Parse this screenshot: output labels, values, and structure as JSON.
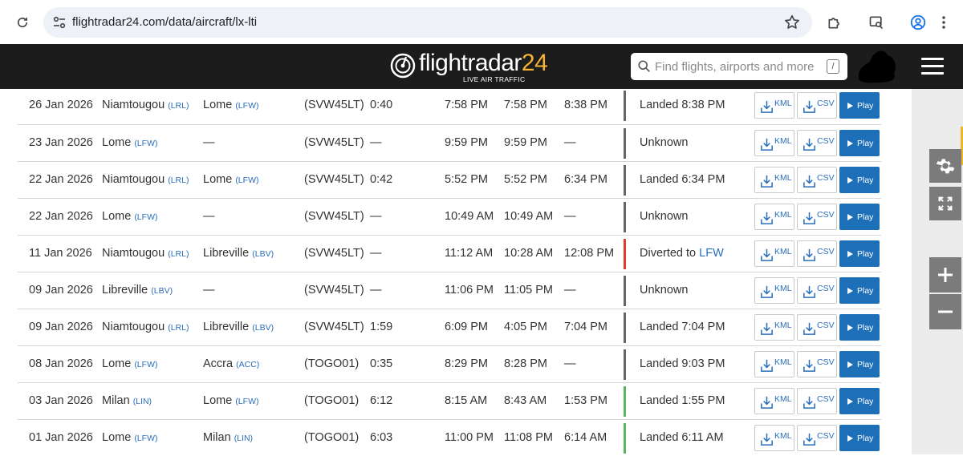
{
  "browser": {
    "url": "flightradar24.com/data/aircraft/lx-lti"
  },
  "header": {
    "logo_text": "flightradar",
    "logo_number": "24",
    "logo_tagline": "LIVE AIR TRAFFIC",
    "search_placeholder": "Find flights, airports and more",
    "search_shortcut": "/"
  },
  "flights": [
    {
      "date": "26 Jan 2026",
      "from": "Niamtougou",
      "from_code": "(LRL)",
      "to": "Lome",
      "to_code": "(LFW)",
      "flight": "(SVW45LT)",
      "duration": "0:40",
      "std": "7:58 PM",
      "atd": "7:58 PM",
      "sta": "8:38 PM",
      "status": "Landed 8:38 PM",
      "status_color": "gray"
    },
    {
      "date": "23 Jan 2026",
      "from": "Lome",
      "from_code": "(LFW)",
      "to": "—",
      "to_code": "",
      "flight": "(SVW45LT)",
      "duration": "—",
      "std": "9:59 PM",
      "atd": "9:59 PM",
      "sta": "—",
      "status": "Unknown",
      "status_color": "gray"
    },
    {
      "date": "22 Jan 2026",
      "from": "Niamtougou",
      "from_code": "(LRL)",
      "to": "Lome",
      "to_code": "(LFW)",
      "flight": "(SVW45LT)",
      "duration": "0:42",
      "std": "5:52 PM",
      "atd": "5:52 PM",
      "sta": "6:34 PM",
      "status": "Landed 6:34 PM",
      "status_color": "gray"
    },
    {
      "date": "22 Jan 2026",
      "from": "Lome",
      "from_code": "(LFW)",
      "to": "—",
      "to_code": "",
      "flight": "(SVW45LT)",
      "duration": "—",
      "std": "10:49 AM",
      "atd": "10:49 AM",
      "sta": "—",
      "status": "Unknown",
      "status_color": "gray"
    },
    {
      "date": "11 Jan 2026",
      "from": "Niamtougou",
      "from_code": "(LRL)",
      "to": "Libreville",
      "to_code": "(LBV)",
      "flight": "(SVW45LT)",
      "duration": "—",
      "std": "11:12 AM",
      "atd": "10:28 AM",
      "sta": "12:08 PM",
      "status": "Diverted to",
      "status_airport": "LFW",
      "status_color": "red"
    },
    {
      "date": "09 Jan 2026",
      "from": "Libreville",
      "from_code": "(LBV)",
      "to": "—",
      "to_code": "",
      "flight": "(SVW45LT)",
      "duration": "—",
      "std": "11:06 PM",
      "atd": "11:05 PM",
      "sta": "—",
      "status": "Unknown",
      "status_color": "gray"
    },
    {
      "date": "09 Jan 2026",
      "from": "Niamtougou",
      "from_code": "(LRL)",
      "to": "Libreville",
      "to_code": "(LBV)",
      "flight": "(SVW45LT)",
      "duration": "1:59",
      "std": "6:09 PM",
      "atd": "4:05 PM",
      "sta": "7:04 PM",
      "status": "Landed 7:04 PM",
      "status_color": "gray"
    },
    {
      "date": "08 Jan 2026",
      "from": "Lome",
      "from_code": "(LFW)",
      "to": "Accra",
      "to_code": "(ACC)",
      "flight": "(TOGO01)",
      "duration": "0:35",
      "std": "8:29 PM",
      "atd": "8:28 PM",
      "sta": "—",
      "status": "Landed 9:03 PM",
      "status_color": "gray"
    },
    {
      "date": "03 Jan 2026",
      "from": "Milan",
      "from_code": "(LIN)",
      "to": "Lome",
      "to_code": "(LFW)",
      "flight": "(TOGO01)",
      "duration": "6:12",
      "std": "8:15 AM",
      "atd": "8:43 AM",
      "sta": "1:53 PM",
      "status": "Landed 1:55 PM",
      "status_color": "green"
    },
    {
      "date": "01 Jan 2026",
      "from": "Lome",
      "from_code": "(LFW)",
      "to": "Milan",
      "to_code": "(LIN)",
      "flight": "(TOGO01)",
      "duration": "6:03",
      "std": "11:00 PM",
      "atd": "11:08 PM",
      "sta": "6:14 AM",
      "status": "Landed 6:11 AM",
      "status_color": "green"
    }
  ],
  "buttons": {
    "kml": "KML",
    "csv": "CSV",
    "play": "Play"
  },
  "colors": {
    "header_bg": "#1c1c1c",
    "accent_blue": "#1d6fb8",
    "link_blue": "#2a6ebb",
    "diverted_red": "#e03c31",
    "landed_green": "#57b95c",
    "logo_yellow": "#f4b333"
  },
  "icons": {
    "reload": "reload-icon",
    "site_settings": "tune-icon",
    "bookmark": "star-icon",
    "extensions": "puzzle-icon",
    "screen_search": "lens-icon",
    "profile": "profile-icon",
    "more": "kebab-icon",
    "settings": "gear-icon",
    "fullscreen": "fullscreen-icon",
    "zoom_in": "plus-icon",
    "zoom_out": "minus-icon"
  }
}
